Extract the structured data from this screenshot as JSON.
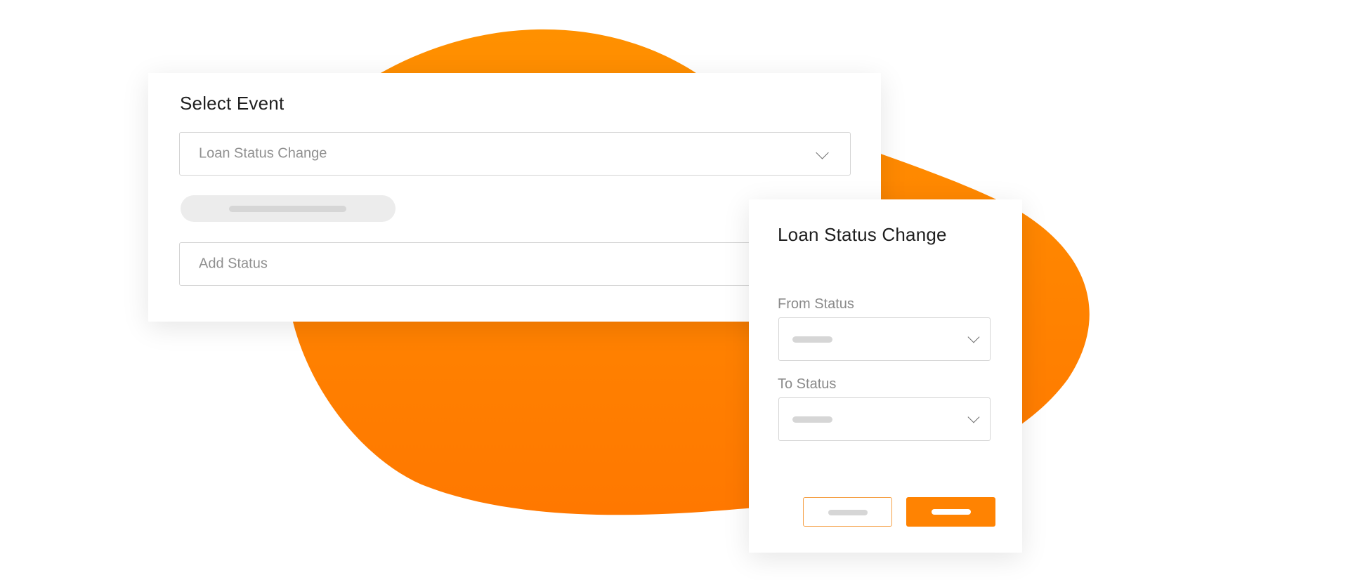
{
  "colors": {
    "accent": "#FF8302",
    "blob": "#FF7E00"
  },
  "event_card": {
    "title": "Select Event",
    "event_select": {
      "value": "Loan Status Change",
      "icon": "chevron-down-icon"
    },
    "add_status": {
      "placeholder": "Add Status"
    }
  },
  "loan_card": {
    "title": "Loan Status Change",
    "from_status": {
      "label": "From Status",
      "icon": "chevron-down-icon"
    },
    "to_status": {
      "label": "To Status",
      "icon": "chevron-down-icon"
    }
  }
}
